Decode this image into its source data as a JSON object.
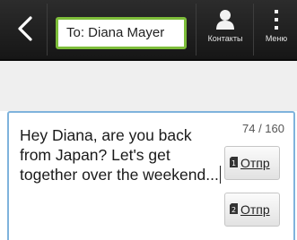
{
  "header": {
    "back_icon": "back-chevron-icon",
    "recipient_value": "To: Diana Mayer",
    "contacts_label": "Контакты",
    "contacts_icon": "person-icon",
    "menu_label": "Меню",
    "menu_icon": "vertical-dots-icon",
    "accent_color": "#7dbd3a"
  },
  "compose": {
    "message_text": "Hey Diana, are you back from Japan? Let's get together over the weekend...",
    "char_counter": "74 / 160",
    "border_color": "#7fb3dc"
  },
  "send_buttons": [
    {
      "label": "Отпр",
      "sim_badge": "1",
      "icon": "sim-card-icon"
    },
    {
      "label": "Отпр",
      "sim_badge": "2",
      "icon": "sim-card-icon"
    }
  ]
}
